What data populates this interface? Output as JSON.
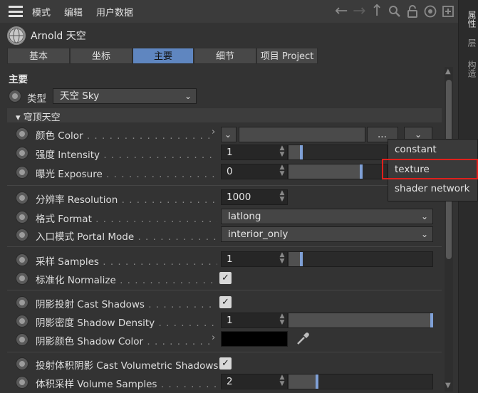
{
  "menu": {
    "items": [
      "模式",
      "编辑",
      "用户数据"
    ]
  },
  "object": {
    "name": "Arnold 天空"
  },
  "tabs": [
    "基本",
    "坐标",
    "主要",
    "细节",
    "项目 Project"
  ],
  "active_tab": "主要",
  "side_tabs": [
    "属性",
    "层",
    "构造"
  ],
  "section": {
    "title": "主要",
    "type_label": "类型",
    "type_value": "天空 Sky",
    "group_title": "穹顶天空"
  },
  "rows": {
    "color": {
      "label": "颜色 Color",
      "dots": " . . . . . . . . . . . . . . . . . . . . . .",
      "btn": "..."
    },
    "intensity": {
      "label": "强度 Intensity",
      "dots": " . . . . . . . . . . . . . . . . . . .",
      "value": "1"
    },
    "exposure": {
      "label": "曝光 Exposure",
      "dots": " . . . . . . . . . . . . . . . . . .",
      "value": "0"
    },
    "resolution": {
      "label": "分辨率 Resolution",
      "dots": " . . . . . . . . . . . . . .",
      "value": "1000"
    },
    "format": {
      "label": "格式 Format",
      "dots": " . . . . . . . . . . . . . . . . . . . . . .",
      "value": "latlong"
    },
    "portal_mode": {
      "label": "入口模式 Portal Mode",
      "dots": " . . . . . . . . . . . .",
      "value": "interior_only"
    },
    "samples": {
      "label": "采样 Samples",
      "dots": " . . . . . . . . . . . . . . . . . . . . .",
      "value": "1"
    },
    "normalize": {
      "label": "标准化 Normalize",
      "dots": " . . . . . . . . . . . . . . . . .",
      "checked": true
    },
    "cast_shadows": {
      "label": "阴影投射 Cast Shadows",
      "dots": " . . . . . . . . . . . .",
      "checked": true
    },
    "shadow_density": {
      "label": "阴影密度 Shadow Density",
      "dots": " . . . . . . . . . .",
      "value": "1"
    },
    "shadow_color": {
      "label": "阴影颜色 Shadow Color",
      "dots": " . . . . . . . . . . . .",
      "color": "#000000"
    },
    "cast_volumetric": {
      "label": "投射体积阴影 Cast Volumetric Shadows",
      "checked": true
    },
    "volume_samples": {
      "label": "体积采样 Volume Samples",
      "dots": " . . . . . . . . . .",
      "value": "2"
    }
  },
  "popup": {
    "items": [
      "constant",
      "texture",
      "shader network"
    ],
    "highlighted": "texture"
  },
  "colors": {
    "accent": "#5f86c0",
    "highlight_border": "#e0201c",
    "slider_knob": "#7fa0d6"
  }
}
